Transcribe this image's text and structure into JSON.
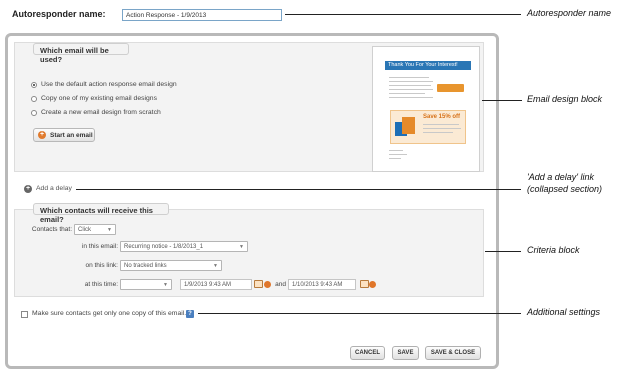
{
  "autoresponder": {
    "label": "Autoresponder name:",
    "value": "Action Response - 1/9/2013"
  },
  "email_section": {
    "legend": "Which email will be used?",
    "options": [
      {
        "label": "Use the default action response email design",
        "selected": true
      },
      {
        "label": "Copy one of my existing email designs",
        "selected": false
      },
      {
        "label": "Create a new email design from scratch",
        "selected": false
      }
    ],
    "start_button": "Start an email",
    "preview": {
      "header": "Thank You For Your Interest!",
      "offer_text": "Save 15% off"
    }
  },
  "delay": {
    "link": "Add a delay"
  },
  "criteria_section": {
    "legend": "Which contacts will receive this email?",
    "contacts_that_label": "Contacts that:",
    "contacts_that_value": "Click",
    "in_this_email_label": "in this email:",
    "in_this_email_value": "Recurring notice - 1/8/2013_1",
    "on_this_link_label": "on this link:",
    "on_this_link_value": "No tracked links",
    "at_this_time_label": "at this time:",
    "at_this_time_value": "",
    "date_from": "1/9/2013 9:43 AM",
    "and_label": "and",
    "date_to": "1/10/2013 9:43 AM"
  },
  "additional": {
    "checkbox_label": "Make sure contacts get only one copy of this email.",
    "checked": false,
    "help_icon": "?"
  },
  "buttons": {
    "cancel": "CANCEL",
    "save": "SAVE",
    "save_close": "SAVE & CLOSE"
  },
  "callouts": {
    "autoresponder_name": "Autoresponder name",
    "email_design_block": "Email design block",
    "add_delay_line1": "'Add a delay' link",
    "add_delay_line2": "(collapsed section)",
    "criteria_block": "Criteria block",
    "additional_settings": "Additional settings"
  },
  "colors": {
    "accent_blue": "#2a76b5",
    "accent_orange": "#e07a2d",
    "section_bg": "#f3f3f3"
  }
}
